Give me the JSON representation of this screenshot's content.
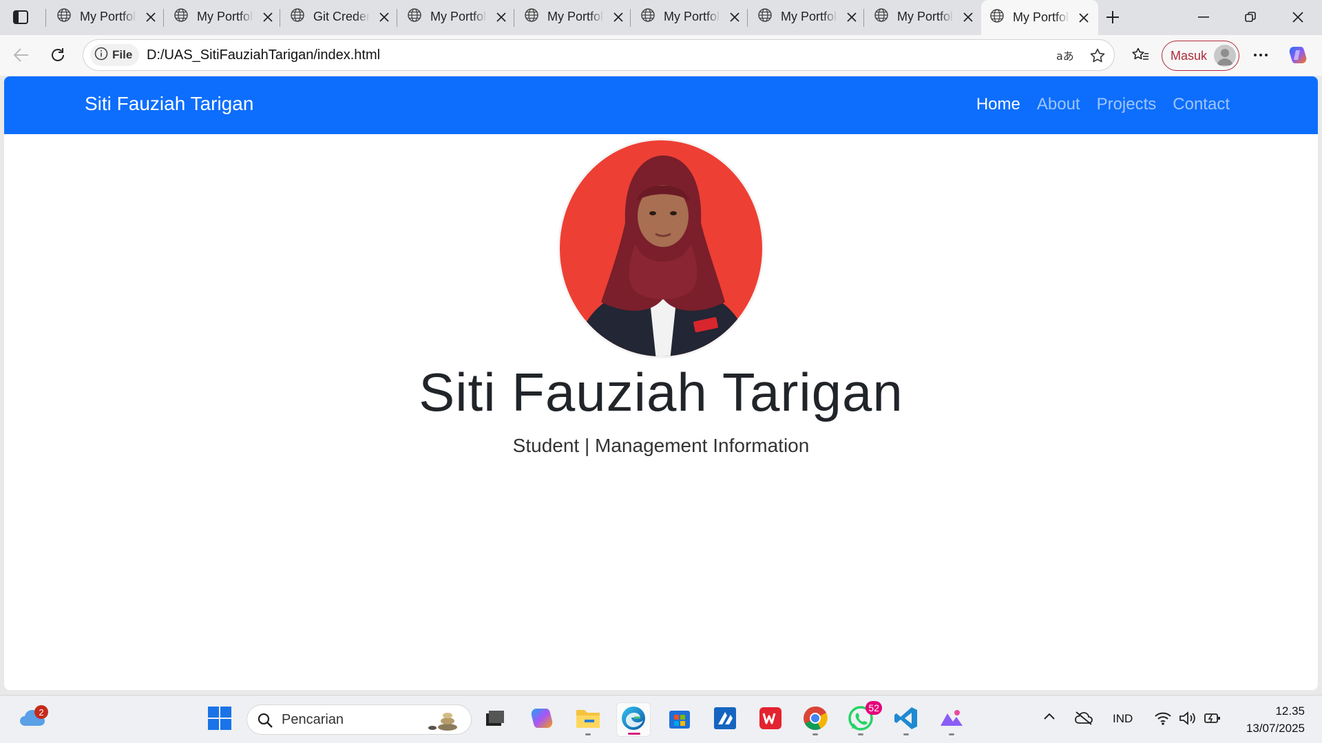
{
  "browser": {
    "tabs": [
      {
        "title": "My Portfolio"
      },
      {
        "title": "My Portfolio"
      },
      {
        "title": "Git Credentials"
      },
      {
        "title": "My Portfolio"
      },
      {
        "title": "My Portfolio"
      },
      {
        "title": "My Portfolio"
      },
      {
        "title": "My Portfolio"
      },
      {
        "title": "My Portfolio"
      },
      {
        "title": "My Portfolio",
        "active": true
      }
    ],
    "address": {
      "file_label": "File",
      "url": "D:/UAS_SitiFauziahTarigan/index.html"
    },
    "signin_label": "Masuk"
  },
  "site": {
    "brand": "Siti Fauziah Tarigan",
    "nav": [
      "Home",
      "About",
      "Projects",
      "Contact"
    ],
    "active_nav": "Home",
    "hero": {
      "name": "Siti Fauziah Tarigan",
      "subtitle": "Student | Management Information"
    },
    "colors": {
      "navbar": "#0d6efd",
      "avatar_bg": "#ee3f34"
    }
  },
  "taskbar": {
    "weather_badge": "2",
    "search_placeholder": "Pencarian",
    "whatsapp_badge": "52",
    "language": "IND",
    "time": "12.35",
    "date": "13/07/2025",
    "apps": [
      "start-icon",
      "task-view-icon",
      "copilot-icon",
      "file-explorer-icon",
      "edge-icon",
      "microsoft-store-icon",
      "editor-icon",
      "wps-office-icon",
      "chrome-icon",
      "whatsapp-icon",
      "vscode-icon",
      "photos-icon"
    ]
  }
}
